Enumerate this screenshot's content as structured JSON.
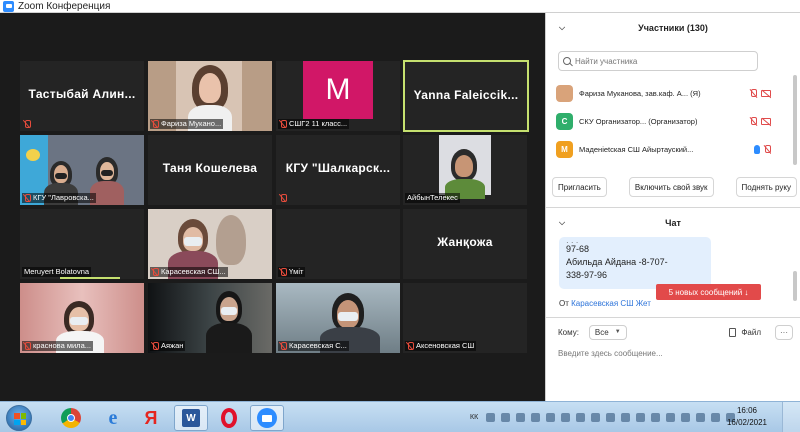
{
  "window": {
    "title": "Zoom Конференция"
  },
  "video_grid": [
    [
      {
        "name": "Тастыбай Алин...",
        "caption": ""
      },
      {
        "name": "",
        "caption": "Фариза Мукано..."
      },
      {
        "name": "",
        "caption": "СШГ2 11 класс...",
        "letter": "M"
      },
      {
        "name": "Yanna Faleiccik...",
        "caption": "",
        "active": true
      }
    ],
    [
      {
        "name": "",
        "caption": "КГУ \"Лавровска..."
      },
      {
        "name": "Таня Кошелева",
        "caption": ""
      },
      {
        "name": "КГУ \"Шалкарск...",
        "caption": ""
      },
      {
        "name": "",
        "caption": "АйбынТелекес"
      }
    ],
    [
      {
        "name": "",
        "caption": "Meruyert Bolatovna"
      },
      {
        "name": "",
        "caption": "Карасевская СШ..."
      },
      {
        "name": "",
        "caption": "Үміт"
      },
      {
        "name": "Жанқожа",
        "caption": ""
      }
    ],
    [
      {
        "name": "",
        "caption": "краснова мила..."
      },
      {
        "name": "",
        "caption": "Аяжан"
      },
      {
        "name": "",
        "caption": "Карасевская С..."
      },
      {
        "name": "",
        "caption": "Аксеновская СШ"
      }
    ]
  ],
  "participants": {
    "title": "Участники (130)",
    "search_placeholder": "Найти участника",
    "items": [
      {
        "avatar_letter": "",
        "avatar_color": "#d9a37a",
        "name": "Фариза Муканова, зав.каф. А... (Я)"
      },
      {
        "avatar_letter": "С",
        "avatar_color": "#2fae6b",
        "name": "СКУ Организатор... (Организатор)"
      },
      {
        "avatar_letter": "М",
        "avatar_color": "#f0a020",
        "name": "Маденietская СШ Айыртауский..."
      }
    ],
    "buttons": {
      "invite": "Пригласить",
      "unmute": "Включить свой звук",
      "raise_hand": "Поднять руку"
    }
  },
  "chat": {
    "title": "Чат",
    "message_lines": [
      "97-68",
      "Абильда Айдана -8-707-",
      "338-97-96"
    ],
    "from_label": "От",
    "from_sender": "Карасевская СШ Жет",
    "new_messages": "5 новых сообщений ↓",
    "to_label": "Кому:",
    "to_value": "Все",
    "file_label": "Файл",
    "more_label": "···",
    "input_placeholder": "Введите здесь сообщение..."
  },
  "taskbar": {
    "language": "КК",
    "time": "16:06",
    "date": "16/02/2021"
  },
  "colors": {
    "zoom_blue": "#2d8cff",
    "active_speaker": "#c5e06f",
    "new_messages_red": "#e24a4a"
  }
}
